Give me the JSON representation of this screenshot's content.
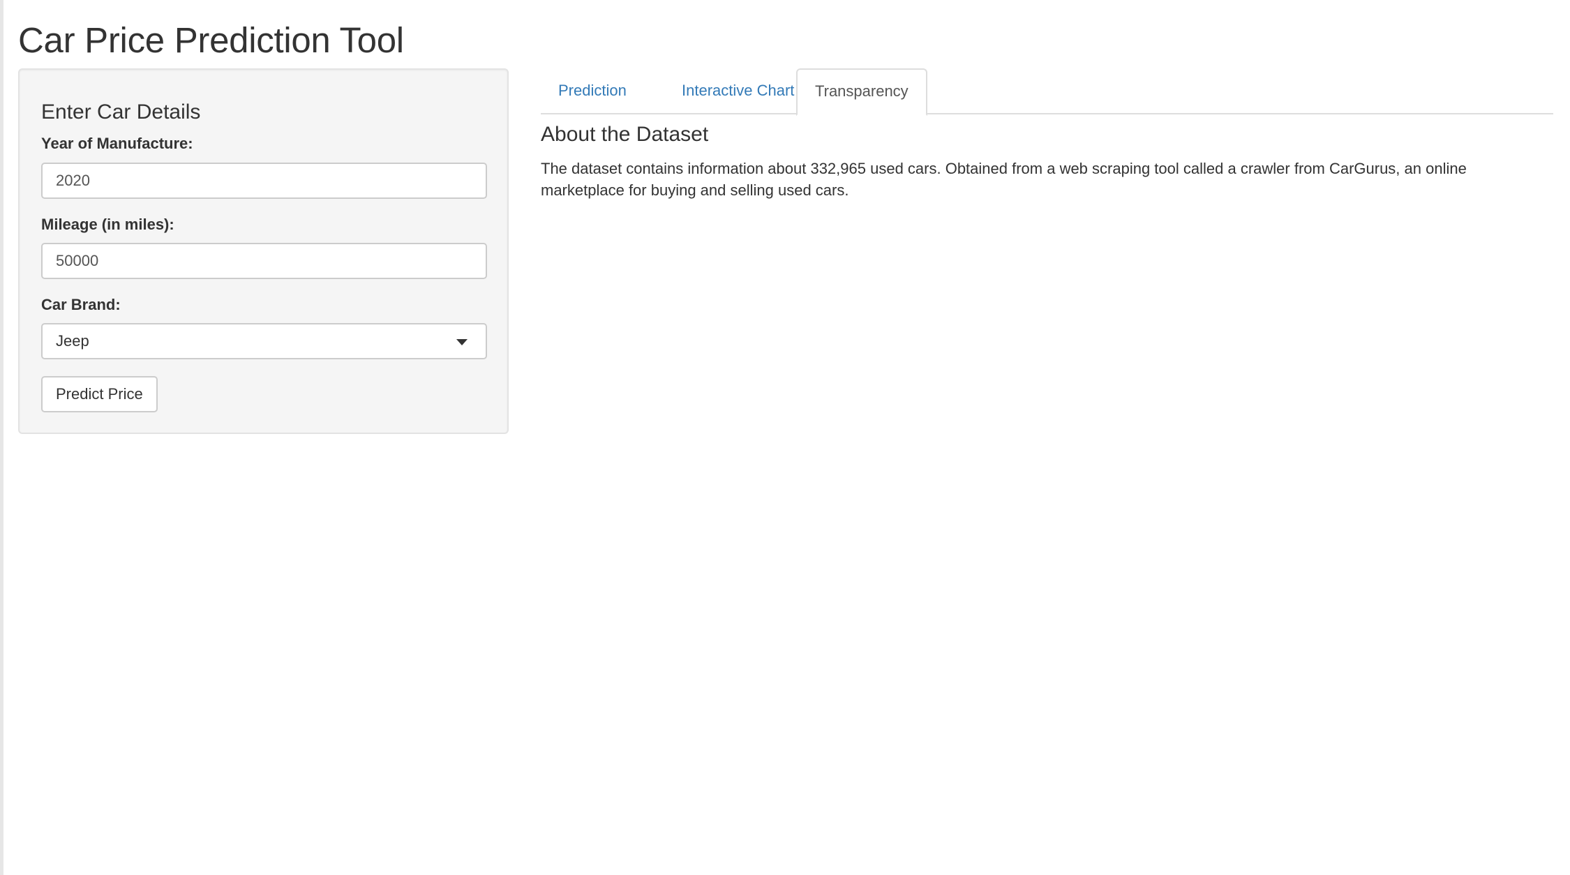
{
  "page": {
    "title": "Car Price Prediction Tool"
  },
  "sidebar": {
    "heading": "Enter Car Details",
    "year": {
      "label": "Year of Manufacture:",
      "value": "2020"
    },
    "mileage": {
      "label": "Mileage (in miles):",
      "value": "50000"
    },
    "brand": {
      "label": "Car Brand:",
      "selected": "Jeep"
    },
    "predict_button": "Predict Price"
  },
  "tabs": [
    {
      "label": "Prediction",
      "active": false
    },
    {
      "label": "Interactive Chart",
      "active": false
    },
    {
      "label": "Transparency",
      "active": true
    }
  ],
  "main": {
    "heading": "About the Dataset",
    "text": "The dataset contains information about 332,965 used cars. Obtained from a web scraping tool called a crawler from CarGurus, an online marketplace for buying and selling used cars."
  },
  "colors": {
    "link": "#337ab7",
    "panel_bg": "#f5f5f5",
    "border": "#dddddd"
  }
}
